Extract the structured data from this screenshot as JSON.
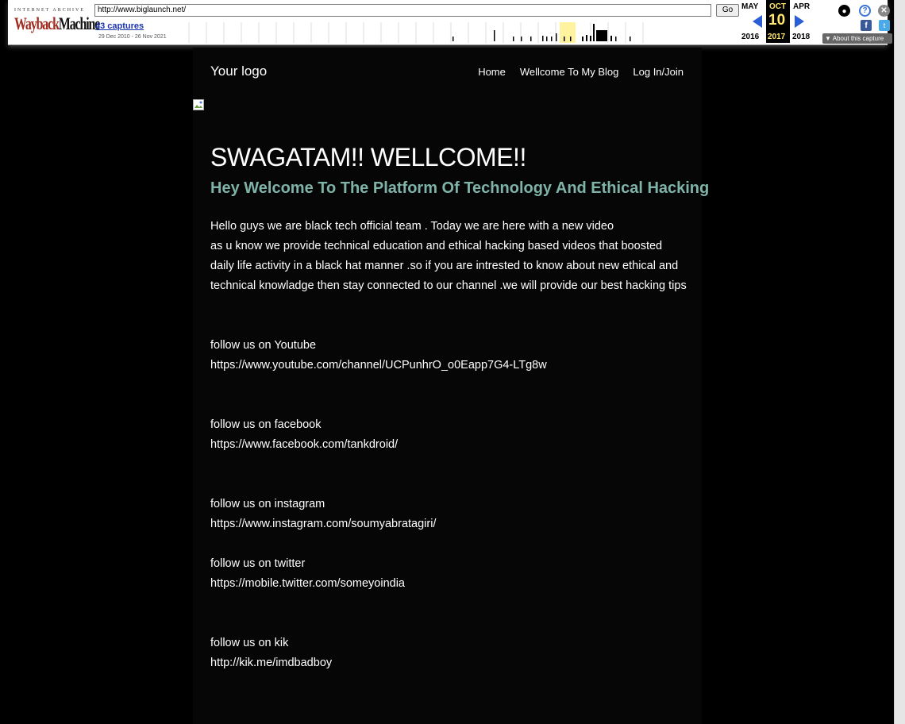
{
  "wayback": {
    "logo_top": "INTERNET ARCHIVE",
    "logo_way": "Wayback",
    "logo_machine": "Machine",
    "url": "http://www.biglaunch.net/",
    "go_label": "Go",
    "captures": "43 captures",
    "date_range": "29 Dec 2010 - 26 Nov 2021",
    "prev_month": "MAY",
    "cur_month": "OCT",
    "next_month": "APR",
    "cur_day": "10",
    "prev_year": "2016",
    "cur_year": "2017",
    "next_year": "2018",
    "about_label": "About this capture",
    "colors": {
      "accent": "#ffe66e",
      "arrow": "#2a5dd6"
    }
  },
  "site": {
    "logo": "Your logo",
    "nav": [
      "Home",
      "Wellcome To My Blog",
      "Log In/Join"
    ],
    "title": "SWAGATAM!! WELLCOME!!",
    "subtitle": "Hey Welcome To The Platform Of Technology And Ethical Hacking",
    "intro": "Hello guys we are black tech official team . Today we are here with a new video\nas u know we provide technical education and ethical hacking based videos that boosted daily life activity in a black hat manner .so if you are intrested to know about new ethical and technical knowladge then stay connected to our channel .we will provide our best hacking tips",
    "socials": [
      {
        "label": "follow us on Youtube",
        "link": "https://www.youtube.com/channel/UCPunhrO_o0Eapp7G4-LTg8w"
      },
      {
        "label": "follow us on facebook",
        "link": "https://www.facebook.com/tankdroid/"
      },
      {
        "label": "follow us on instagram",
        "link": "https://www.instagram.com/soumyabratagiri/"
      },
      {
        "label": "follow us on twitter",
        "link": "https://mobile.twitter.com/someyoindia"
      },
      {
        "label": "follow us on kik",
        "link": "http://kik.me/imdbadboy"
      }
    ],
    "colors": {
      "background": "#000000",
      "subtitle": "#7fb3a8"
    }
  }
}
